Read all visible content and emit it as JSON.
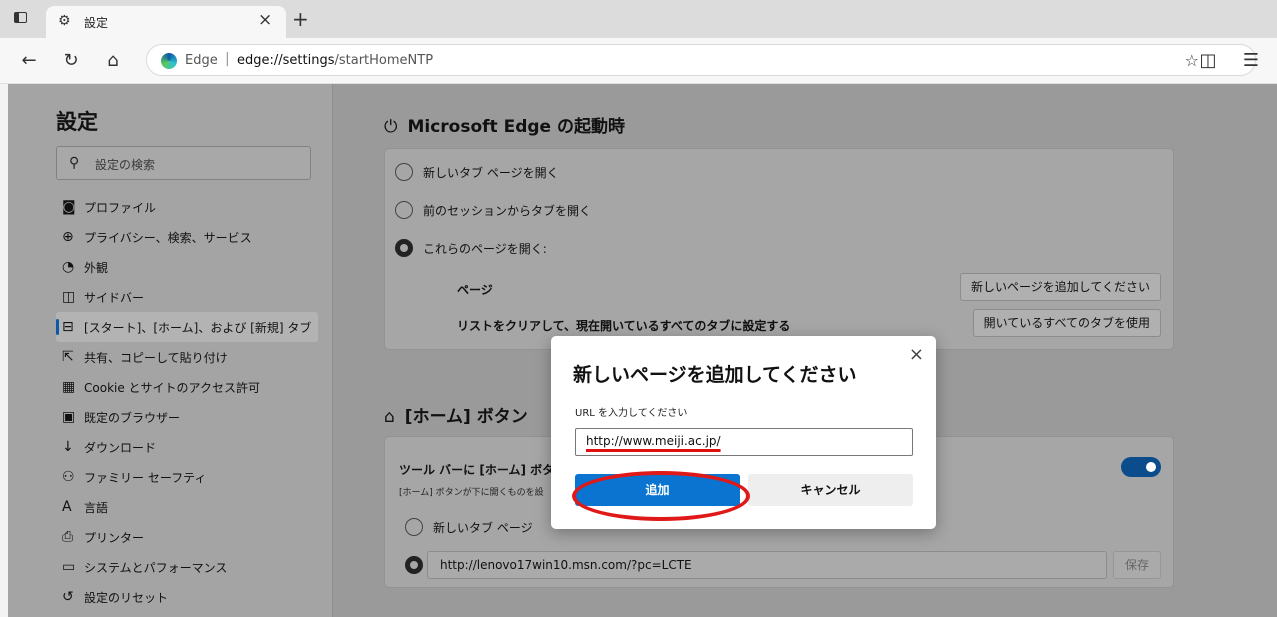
{
  "browser": {
    "tab_title": "設定",
    "tab_close": "×",
    "new_tab": "+",
    "brand": "Edge",
    "separator": "|",
    "url_host": "edge://settings",
    "url_path": "/startHomeNTP"
  },
  "sidebar": {
    "title": "設定",
    "search_placeholder": "設定の検索",
    "items": [
      {
        "icon": "profile-icon",
        "label": "プロファイル"
      },
      {
        "icon": "lock-icon",
        "label": "プライバシー、検索、サービス"
      },
      {
        "icon": "palette-icon",
        "label": "外観"
      },
      {
        "icon": "sidebar-icon",
        "label": "サイドバー"
      },
      {
        "icon": "home-tab-icon",
        "label": "[スタート]、[ホーム]、および [新規] タブ",
        "active": true
      },
      {
        "icon": "share-icon",
        "label": "共有、コピーして貼り付け"
      },
      {
        "icon": "cookie-icon",
        "label": "Cookie とサイトのアクセス許可"
      },
      {
        "icon": "browser-icon",
        "label": "既定のブラウザー"
      },
      {
        "icon": "download-icon",
        "label": "ダウンロード"
      },
      {
        "icon": "family-icon",
        "label": "ファミリー セーフティ"
      },
      {
        "icon": "language-icon",
        "label": "言語"
      },
      {
        "icon": "printer-icon",
        "label": "プリンター"
      },
      {
        "icon": "system-icon",
        "label": "システムとパフォーマンス"
      },
      {
        "icon": "reset-icon",
        "label": "設定のリセット"
      }
    ]
  },
  "startup": {
    "title": "Microsoft Edge の起動時",
    "options": [
      "新しいタブ ページを開く",
      "前のセッションからタブを開く",
      "これらのページを開く:"
    ],
    "pages_label": "ページ",
    "add_page_button": "新しいページを追加してください",
    "clear_label": "リストをクリアして、現在開いているすべてのタブに設定する",
    "use_tabs_button": "開いているすべてのタブを使用"
  },
  "home": {
    "title": "[ホーム] ボタン",
    "toolbar_label": "ツール バーに [ホーム] ボタンを",
    "toolbar_desc": "[ホーム] ボタンが下に開くものを設",
    "option_newtab": "新しいタブ ページ",
    "home_url": "http://lenovo17win10.msn.com/?pc=LCTE",
    "save_button": "保存"
  },
  "dialog": {
    "title": "新しいページを追加してください",
    "label": "URL を入力してください",
    "input_value": "http://www.meiji.ac.jp/",
    "add_button": "追加",
    "cancel_button": "キャンセル",
    "close": "×"
  },
  "colors": {
    "accent": "#0a74d0",
    "highlight": "#e01818"
  }
}
